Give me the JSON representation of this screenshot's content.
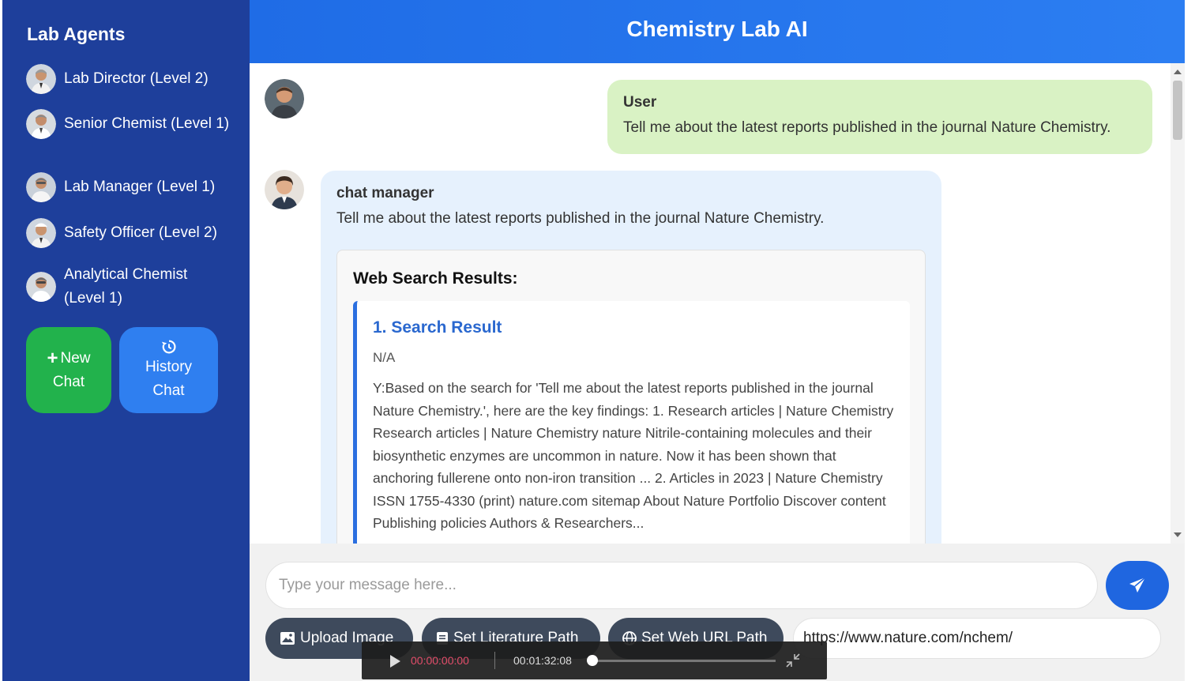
{
  "sidebar": {
    "title": "Lab Agents",
    "agents": [
      {
        "label": "Lab Director (Level 2)"
      },
      {
        "label": "Senior Chemist (Level 1)"
      },
      {
        "label": "Lab Manager (Level 1)"
      },
      {
        "label": "Safety Officer (Level 2)"
      },
      {
        "label": "Analytical Chemist (Level 1)"
      }
    ],
    "new_chat": {
      "line1": "New",
      "line2": "Chat",
      "icon": "plus-icon"
    },
    "history_chat": {
      "line1": "History",
      "line2": "Chat",
      "icon": "history-icon"
    }
  },
  "header": {
    "title": "Chemistry Lab AI"
  },
  "chat": {
    "user_message": {
      "sender": "User",
      "text": "Tell me about the latest reports published in the journal Nature Chemistry."
    },
    "bot_message": {
      "sender": "chat manager",
      "text": "Tell me about the latest reports published in the journal Nature Chemistry.",
      "search_heading": "Web Search Results:",
      "result": {
        "title": "1. Search Result",
        "meta": "N/A",
        "body": "Y:Based on the search for 'Tell me about the latest reports published in the journal Nature Chemistry.', here are the key findings: 1. Research articles | Nature Chemistry Research articles | Nature Chemistry nature Nitrile-containing molecules and their biosynthetic enzymes are uncommon in nature. Now it has been shown that anchoring fullerene onto non-iron transition ... 2. Articles in 2023 | Nature Chemistry ISSN 1755-4330 (print) nature.com sitemap About Nature Portfolio Discover content Publishing policies Authors & Researchers..."
      }
    }
  },
  "input": {
    "placeholder": "Type your message here...",
    "value": "",
    "send_icon": "paper-plane-icon",
    "upload_image": "Upload Image",
    "set_literature_path": "Set Literature Path",
    "set_web_url_path": "Set Web URL Path",
    "url_value": "https://www.nature.com/nchem/"
  },
  "player": {
    "current_time": "00:00:00:00",
    "total_time": "00:01:32:08",
    "progress": 0
  },
  "colors": {
    "sidebar_bg": "#1e3f9b",
    "header_bg": "#2c7ef2",
    "new_chat_bg": "#22b24c",
    "history_bg": "#2f7ff0",
    "user_bubble": "#d9f2c4",
    "bot_bubble": "#e6f1fd",
    "result_accent": "#2b6fe0"
  }
}
